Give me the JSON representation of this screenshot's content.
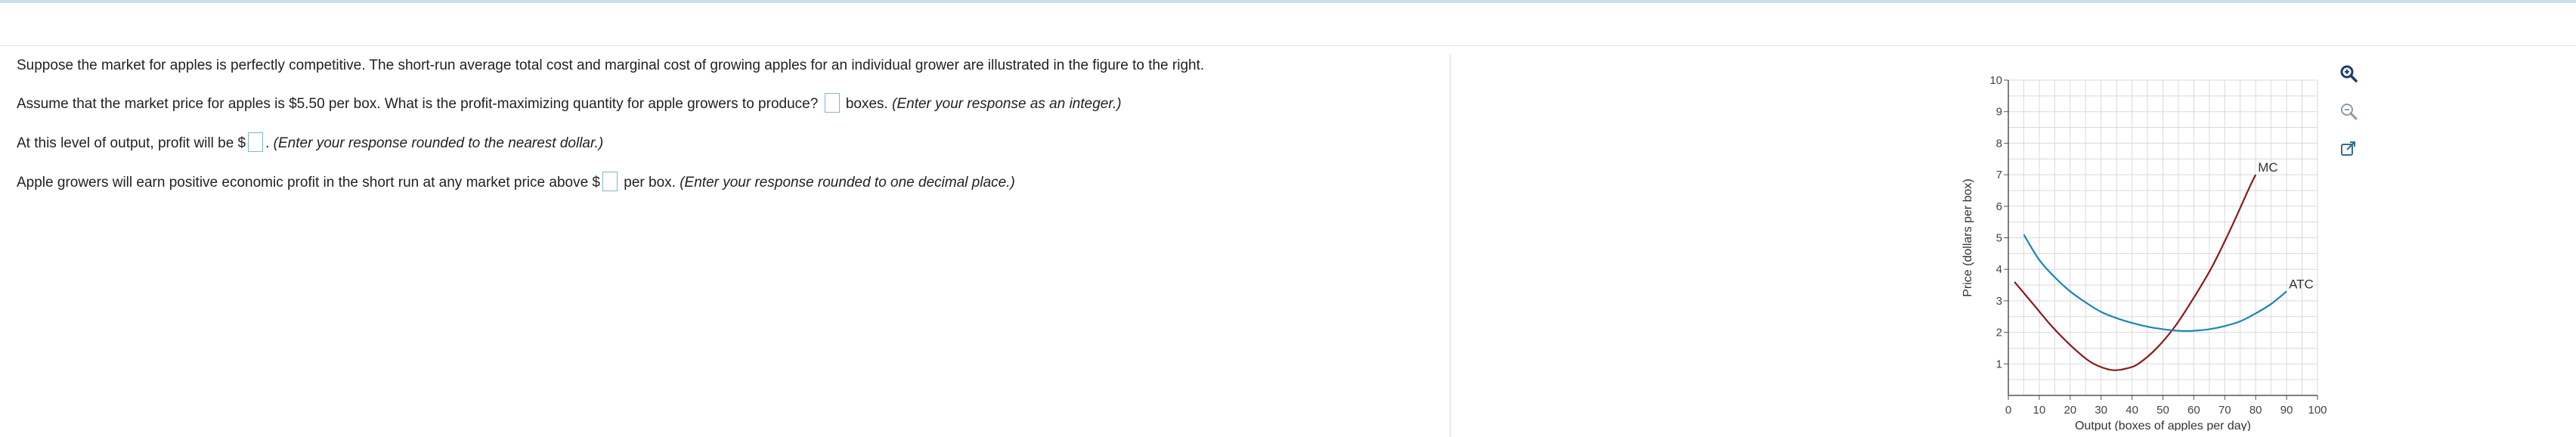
{
  "question": {
    "line1": "Suppose the market for apples is perfectly competitive.  The short-run average total cost and marginal cost of growing apples for an individual grower are illustrated in the figure to the right.",
    "line2_pre": "Assume that the market price for apples is $5.50 per box. What is the profit-maximizing quantity for apple growers to produce?",
    "line2_post": "boxes.",
    "line2_instr": "(Enter your response as an integer.)",
    "line3_pre": "At this level of output, profit will be $",
    "line3_post": ".",
    "line3_instr": "(Enter your response rounded to the nearest dollar.)",
    "line4_pre": "Apple growers will earn positive economic profit in the short run at any market price above $",
    "line4_post": "per box.",
    "line4_instr": "(Enter your response rounded to one decimal place.)"
  },
  "tools": [
    {
      "name": "zoom-in-icon",
      "color": "#1c3c6e"
    },
    {
      "name": "zoom-out-icon",
      "color": "#8a9aa8"
    },
    {
      "name": "popout-icon",
      "color": "#2f6f8f"
    }
  ],
  "chart_data": {
    "type": "line",
    "xlabel": "Output (boxes of apples per day)",
    "ylabel": "Price (dollars per box)",
    "xlim": [
      0,
      100
    ],
    "ylim": [
      0,
      10
    ],
    "xticks": [
      0,
      10,
      20,
      30,
      40,
      50,
      60,
      70,
      80,
      90,
      100
    ],
    "yticks": [
      1,
      2,
      3,
      4,
      5,
      6,
      7,
      8,
      9,
      10
    ],
    "grid": true,
    "series": [
      {
        "name": "MC",
        "color": "#8b1a1a",
        "x": [
          2,
          8,
          14,
          20,
          26,
          30,
          34,
          38,
          42,
          48,
          54,
          60,
          66,
          72,
          78,
          80
        ],
        "y": [
          3.6,
          2.9,
          2.2,
          1.6,
          1.1,
          0.9,
          0.8,
          0.85,
          1.0,
          1.5,
          2.2,
          3.1,
          4.1,
          5.3,
          6.6,
          7.0
        ]
      },
      {
        "name": "ATC",
        "color": "#1b85b8",
        "x": [
          5,
          10,
          15,
          20,
          25,
          30,
          35,
          40,
          45,
          50,
          55,
          60,
          65,
          70,
          75,
          80,
          85,
          90
        ],
        "y": [
          5.1,
          4.3,
          3.75,
          3.3,
          2.95,
          2.65,
          2.45,
          2.3,
          2.18,
          2.1,
          2.05,
          2.05,
          2.1,
          2.2,
          2.35,
          2.6,
          2.9,
          3.3
        ]
      }
    ]
  }
}
